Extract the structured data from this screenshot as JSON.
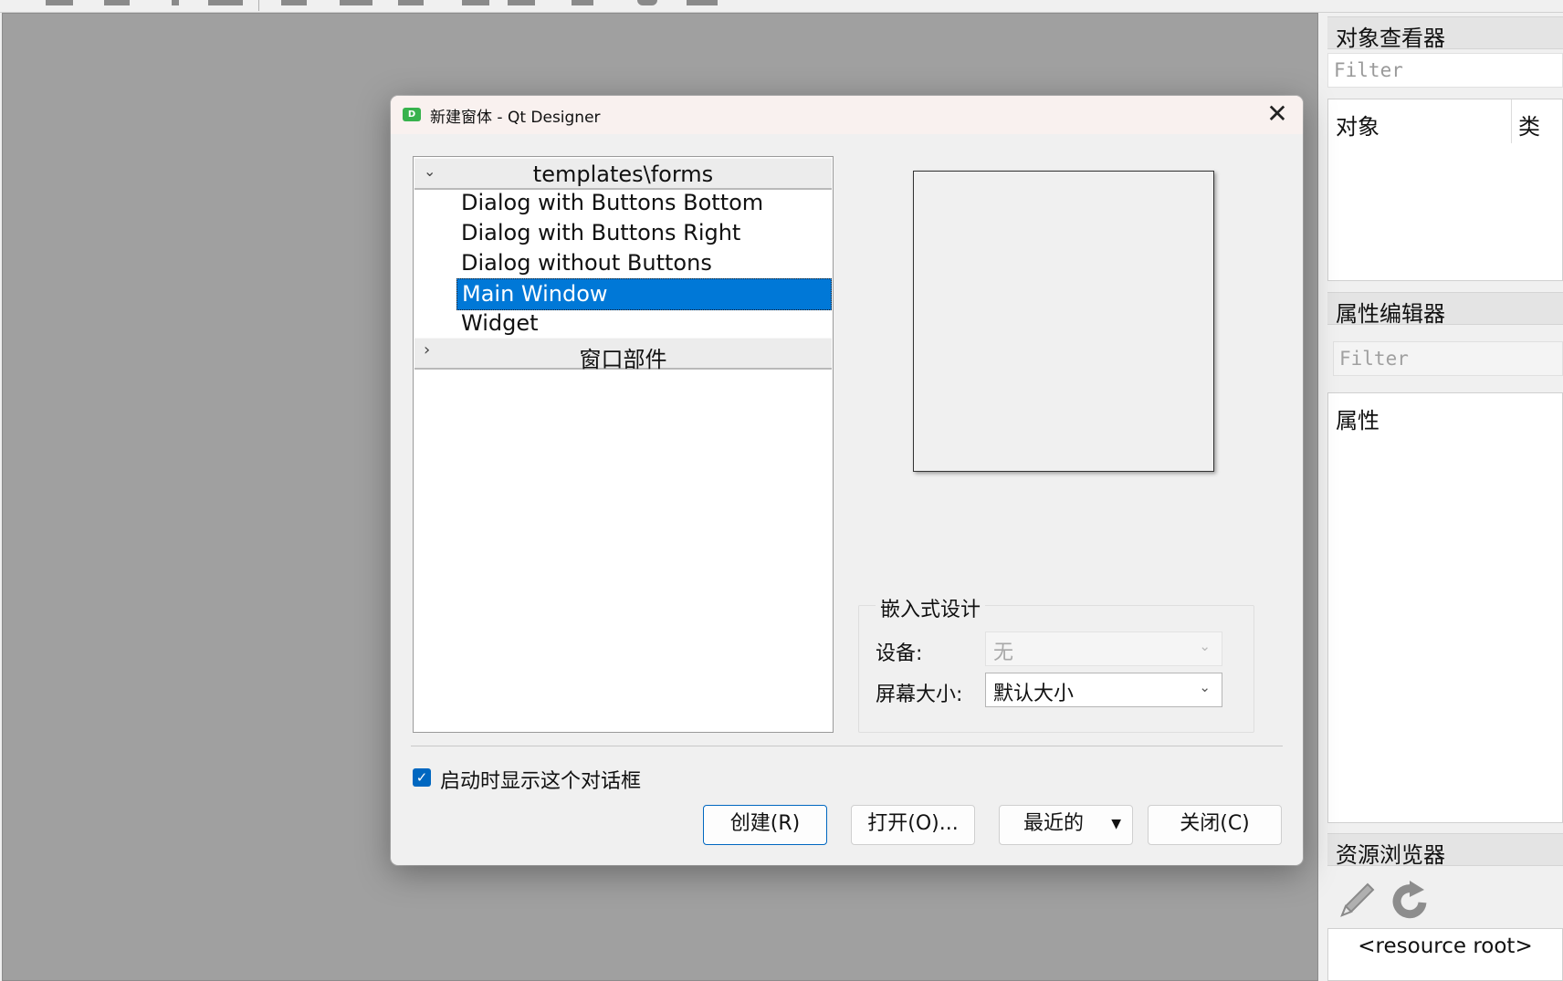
{
  "window": {
    "dialog_title": "新建窗体 - Qt Designer",
    "app_icon_letter": "D"
  },
  "docks": {
    "object_inspector": {
      "title": "对象查看器",
      "filter_placeholder": "Filter",
      "col_object": "对象",
      "col_class": "类"
    },
    "property_editor": {
      "title": "属性编辑器",
      "filter_placeholder": "Filter",
      "col_property": "属性"
    },
    "resource_browser": {
      "title": "资源浏览器",
      "root": "<resource root>"
    }
  },
  "templates": {
    "group_forms": "templates\\forms",
    "items": [
      "Dialog with Buttons Bottom",
      "Dialog with Buttons Right",
      "Dialog without Buttons",
      "Main Window",
      "Widget"
    ],
    "selected_index": 3,
    "group_widgets": "窗口部件"
  },
  "embedded": {
    "title": "嵌入式设计",
    "device_label": "设备:",
    "device_value": "无",
    "screen_label": "屏幕大小:",
    "screen_value": "默认大小"
  },
  "startup": {
    "checked": true,
    "label": "启动时显示这个对话框"
  },
  "buttons": {
    "create": "创建(R)",
    "open": "打开(O)...",
    "recent": "最近的",
    "close": "关闭(C)"
  }
}
